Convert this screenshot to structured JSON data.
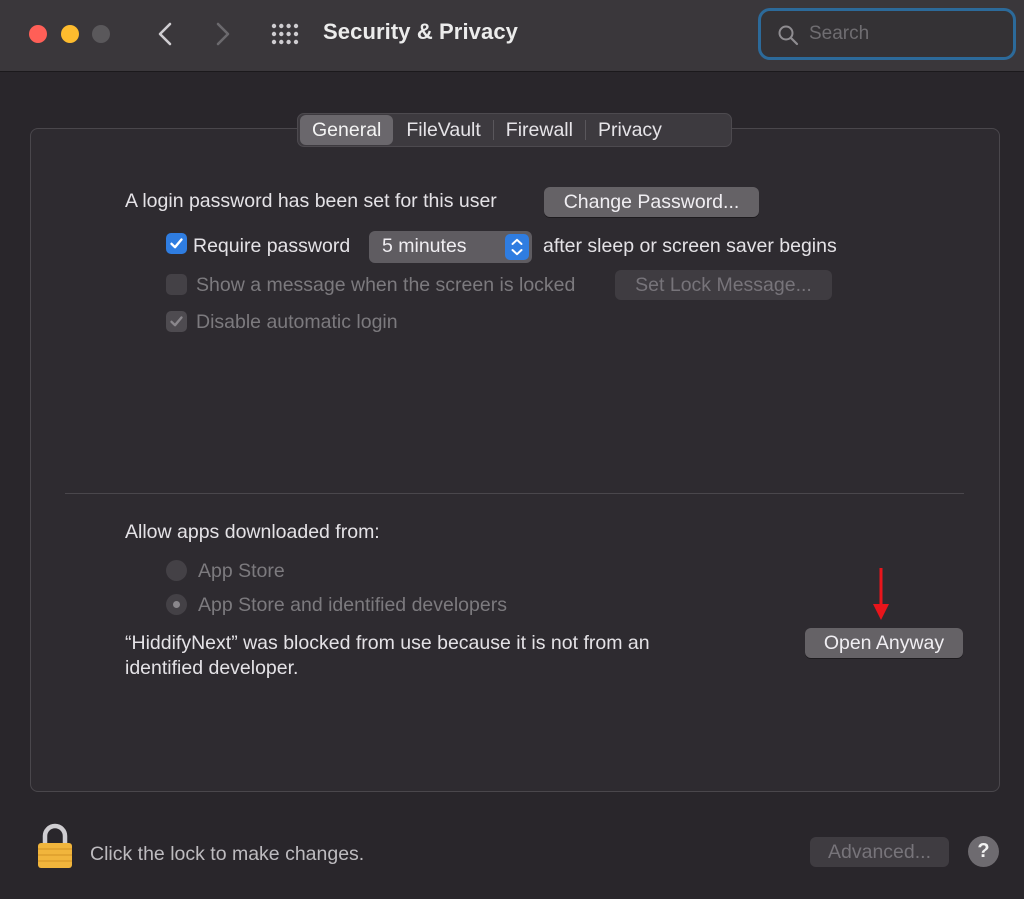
{
  "window": {
    "title": "Security & Privacy"
  },
  "search": {
    "placeholder": "Search",
    "value": ""
  },
  "tabs": [
    {
      "label": "General",
      "active": true
    },
    {
      "label": "FileVault",
      "active": false
    },
    {
      "label": "Firewall",
      "active": false
    },
    {
      "label": "Privacy",
      "active": false
    }
  ],
  "general": {
    "login_text": "A login password has been set for this user",
    "change_password_label": "Change Password...",
    "require_password_label": "Require password",
    "require_password_checked": true,
    "require_password_delay": "5 minutes",
    "after_sleep_text": "after sleep or screen saver begins",
    "show_message_label": "Show a message when the screen is locked",
    "show_message_checked": false,
    "set_lock_message_label": "Set Lock Message...",
    "disable_auto_login_label": "Disable automatic login",
    "disable_auto_login_checked": true
  },
  "downloads": {
    "heading": "Allow apps downloaded from:",
    "options": [
      {
        "label": "App Store",
        "selected": false
      },
      {
        "label": "App Store and identified developers",
        "selected": true
      }
    ],
    "blocked_line1": "“HiddifyNext” was blocked from use because it is not from an",
    "blocked_line2": "identified developer.",
    "open_anyway_label": "Open Anyway"
  },
  "footer": {
    "lock_text": "Click the lock to make changes.",
    "advanced_label": "Advanced...",
    "help_label": "?"
  },
  "colors": {
    "accent": "#2f7de1",
    "annotation": "#e8151b",
    "search_focus": "#2c6a9a"
  }
}
